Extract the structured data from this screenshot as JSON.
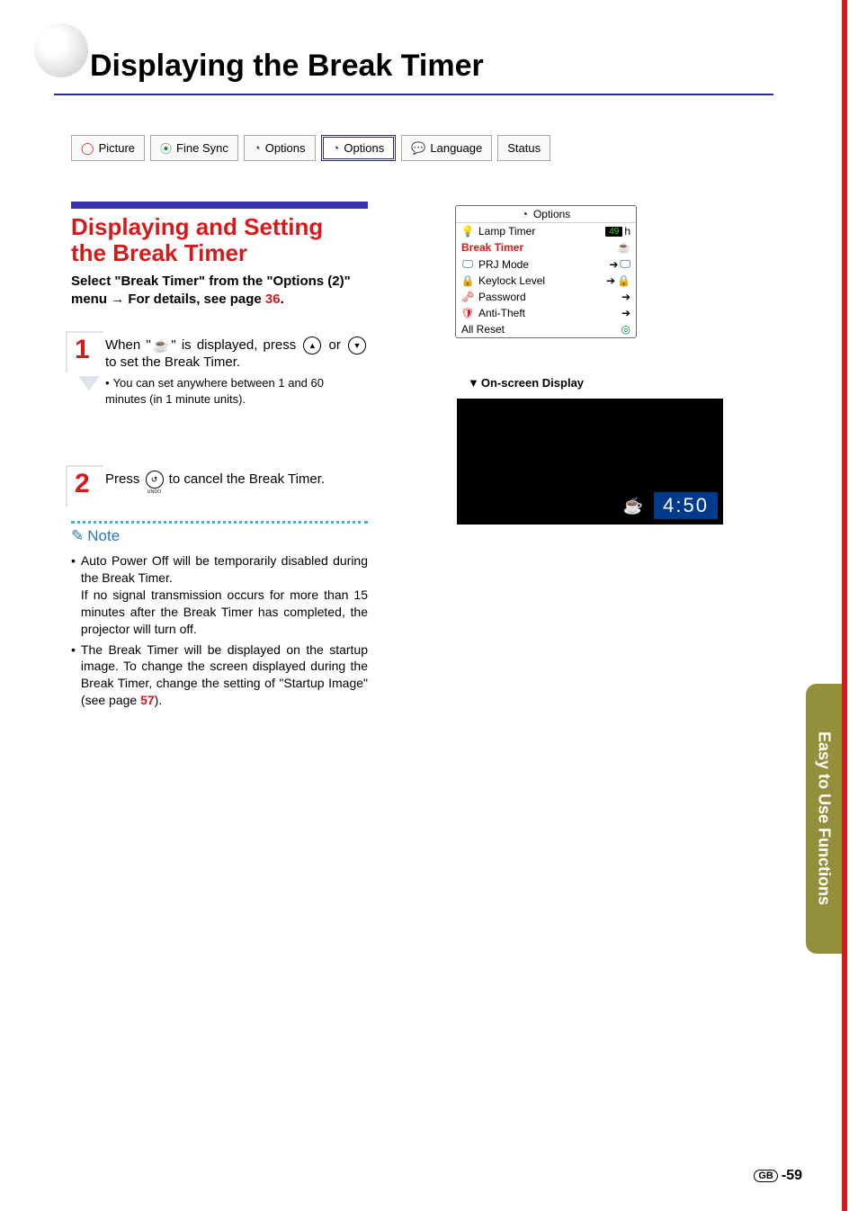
{
  "page_title": "Displaying the Break Timer",
  "tabs": [
    {
      "icon": "◯",
      "icon_color": "#d92b2b",
      "label": "Picture"
    },
    {
      "icon": "⦿",
      "icon_color": "#1a8a3a",
      "label": "Fine Sync"
    },
    {
      "icon": "◔",
      "icon_color": "#3a3a3a",
      "label": "Options"
    },
    {
      "icon": "◔",
      "icon_color": "#3a3a3a",
      "label": "Options",
      "selected": true
    },
    {
      "icon": "💬",
      "icon_color": "#3a3a3a",
      "label": "Language"
    },
    {
      "icon": "",
      "icon_color": "#3a3a3a",
      "label": "Status"
    }
  ],
  "section_heading_line1": "Displaying and Setting",
  "section_heading_line2": "the Break Timer",
  "lead_part1": "Select \"Break Timer\" from the \"Options (2)\" menu ",
  "lead_arrow": "→",
  "lead_part2": " For details, see page ",
  "lead_page": "36",
  "lead_end": ".",
  "step1": {
    "num": "1",
    "prefix": "When \"",
    "mug": "☕",
    "after_mug": "\" is displayed, press ",
    "btn_up": "▲",
    "or": " or ",
    "btn_down": "▼",
    "tail": " to set the Break Timer.",
    "note_bullet": "•",
    "note": "You can set anywhere between 1 and 60 minutes (in 1 minute units)."
  },
  "step2": {
    "num": "2",
    "prefix": "Press ",
    "btn_undo": "↺",
    "tail": " to cancel the Break Timer."
  },
  "note_label": "Note",
  "notes": [
    "Auto Power Off will be temporarily disabled during the Break Timer.\nIf no signal transmission occurs for more than 15 minutes after the Break Timer has completed, the projector will turn off.",
    "The Break Timer will be displayed on the startup image. To change the screen displayed during the Break Timer, change the setting of \"Startup Image\" (see page "
  ],
  "note2_page": "57",
  "note2_end": ").",
  "options_panel": {
    "title_icon": "◔",
    "title": "Options",
    "rows": [
      {
        "icon": "💡",
        "icon_color": "#d09b1f",
        "label": "Lamp Timer",
        "value_badge": "49",
        "value_unit": " h"
      },
      {
        "label": "Break Timer",
        "active": true,
        "right_icon": "☕"
      },
      {
        "icon": "🖵",
        "icon_color": "#0a3aa0",
        "label": "PRJ Mode",
        "right_arrow": true,
        "right_icon": "🖵"
      },
      {
        "icon": "🔒",
        "icon_color": "#bfa000",
        "label": "Keylock Level",
        "right_arrow": true,
        "right_icon": "🔒"
      },
      {
        "icon": "🗝",
        "icon_color": "#d61a1a",
        "label": "Password",
        "right_arrow": true
      },
      {
        "icon": "🛡",
        "icon_color": "#c22",
        "label": "Anti-Theft",
        "right_arrow": true
      },
      {
        "label": "All Reset",
        "right_icon": "◎",
        "right_icon_color": "#0a8a4a"
      }
    ]
  },
  "osd_heading_tri": "▼",
  "osd_heading": "On-screen Display",
  "osd_time": "4:50",
  "side_tab": "Easy to Use Functions",
  "page_number_prefix": "GB",
  "page_number": "-59"
}
